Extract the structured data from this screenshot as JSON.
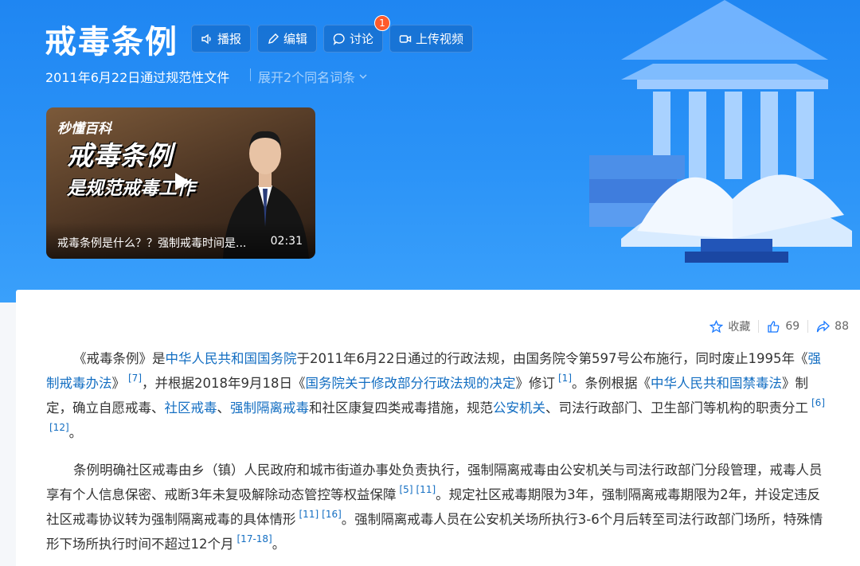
{
  "header": {
    "title": "戒毒条例",
    "buttons": {
      "broadcast": "播报",
      "edit": "编辑",
      "discuss": "讨论",
      "upload_video": "上传视频"
    },
    "discuss_badge": "1",
    "subtitle": "2011年6月22日通过规范性文件",
    "expand_label": "展开2个同名词条"
  },
  "video": {
    "logo": "秒懂百科",
    "title_line1": "戒毒条例",
    "title_line2": "是规范戒毒工作",
    "caption": "戒毒条例是什么？？强制戒毒时间是...",
    "duration": "02:31"
  },
  "actions": {
    "favorite": "收藏",
    "likes": "69",
    "shares": "88"
  },
  "paragraph1": {
    "t0": "《戒毒条例》是",
    "l0": "中华人民共和国国务院",
    "t1": "于2011年6月22日通过的行政法规，由国务院令第597号公布施行，同时废止1995年《",
    "l1": "强制戒毒办法",
    "t2": "》",
    "r0": "[7]",
    "t3": "，并根据2018年9月18日《",
    "l2": "国务院关于修改部分行政法规的决定",
    "t4": "》修订",
    "r1": "[1]",
    "t5": "。条例根据《",
    "l3": "中华人民共和国禁毒法",
    "t6": "》制定，确立自愿戒毒、",
    "l4": "社区戒毒",
    "t7": "、",
    "l5": "强制隔离戒毒",
    "t8": "和社区康复四类戒毒措施，规范",
    "l6": "公安机关",
    "t9": "、司法行政部门、卫生部门等机构的职责分工",
    "r2": "[6]",
    "r3": "[12]",
    "t10": "。"
  },
  "paragraph2": {
    "t0": "条例明确社区戒毒由乡（镇）人民政府和城市街道办事处负责执行，强制隔离戒毒由公安机关与司法行政部门分段管理，戒毒人员享有个人信息保密、戒断3年未复吸解除动态管控等权益保障",
    "r0": "[5]",
    "r1": "[11]",
    "t1": "。规定社区戒毒期限为3年，强制隔离戒毒期限为2年，并设定违反社区戒毒协议转为强制隔离戒毒的具体情形",
    "r2": "[11]",
    "r3": "[16]",
    "t2": "。强制隔离戒毒人员在公安机关场所执行3-6个月后转至司法行政部门场所，特殊情形下场所执行时间不超过12个月",
    "r4": "[17-18]",
    "t3": "。"
  },
  "colors": {
    "hero": "#1f86f2",
    "link": "#136ec2",
    "badge": "#ff5a2b"
  },
  "icons": [
    "speaker-icon",
    "pencil-icon",
    "chat-icon",
    "video-camera-icon",
    "chevron-down-icon",
    "play-icon",
    "star-icon",
    "thumbs-up-icon",
    "share-icon"
  ]
}
